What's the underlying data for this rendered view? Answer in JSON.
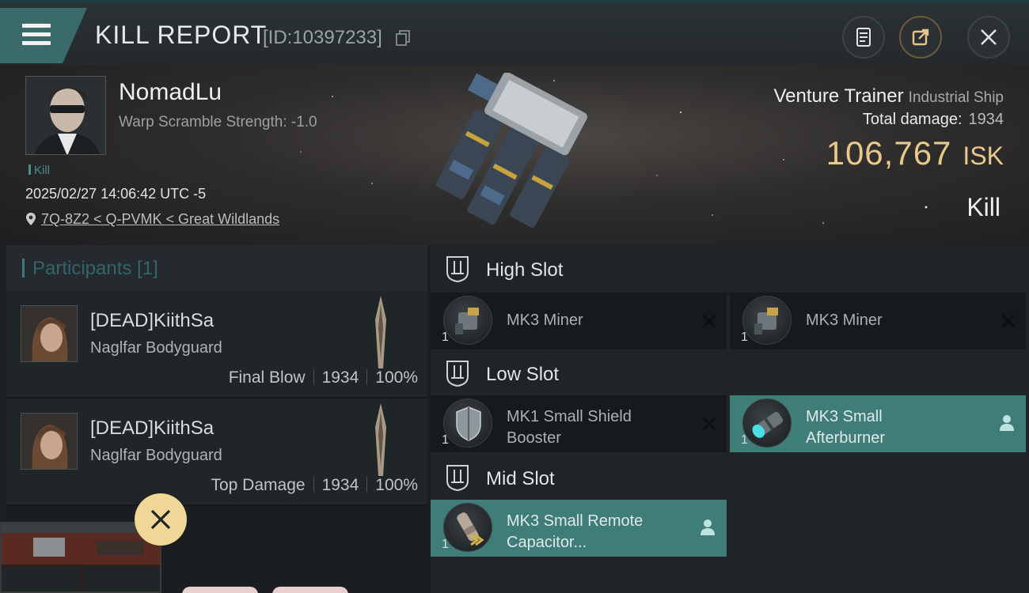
{
  "header": {
    "title": "KILL REPORT",
    "report_id": "[ID:10397233]",
    "icons": [
      "menu-icon",
      "copy-icon",
      "document-icon",
      "share-icon",
      "close-icon"
    ]
  },
  "victim": {
    "pilot_name": "NomadLu",
    "warp_scramble": "Warp Scramble Strength: -1.0",
    "kill_tag": "Kill",
    "datetime": "2025/02/27 14:06:42 UTC -5",
    "location": "7Q-8Z2 < Q-PVMK < Great Wildlands"
  },
  "ship": {
    "name": "Venture Trainer",
    "class": "Industrial Ship",
    "total_damage_label": "Total damage:",
    "total_damage": "1934",
    "isk_value": "106,767",
    "isk_unit": "ISK",
    "result": "Kill"
  },
  "participants": {
    "title": "Participants [1]",
    "items": [
      {
        "name": "[DEAD]KiithSa",
        "corp": "Naglfar Bodyguard",
        "role": "Final Blow",
        "damage": "1934",
        "percent": "100%"
      },
      {
        "name": "[DEAD]KiithSa",
        "corp": "Naglfar Bodyguard",
        "role": "Top Damage",
        "damage": "1934",
        "percent": "100%"
      }
    ]
  },
  "slots": {
    "high": {
      "title": "High Slot",
      "modules": [
        {
          "name": "MK3 Miner",
          "qty": "1"
        },
        {
          "name": "MK3 Miner",
          "qty": "1"
        }
      ]
    },
    "low": {
      "title": "Low Slot",
      "modules": [
        {
          "name": "MK1 Small Shield Booster",
          "qty": "1"
        },
        {
          "name": "MK3 Small Afterburner",
          "qty": "1"
        }
      ]
    },
    "mid": {
      "title": "Mid Slot",
      "modules": [
        {
          "name": "MK3 Small Remote Capacitor...",
          "qty": "1"
        }
      ]
    }
  },
  "colors": {
    "accent_teal": "#3f7d79",
    "isk_gold": "#e8c98b",
    "overlay_close": "#f0d797"
  }
}
